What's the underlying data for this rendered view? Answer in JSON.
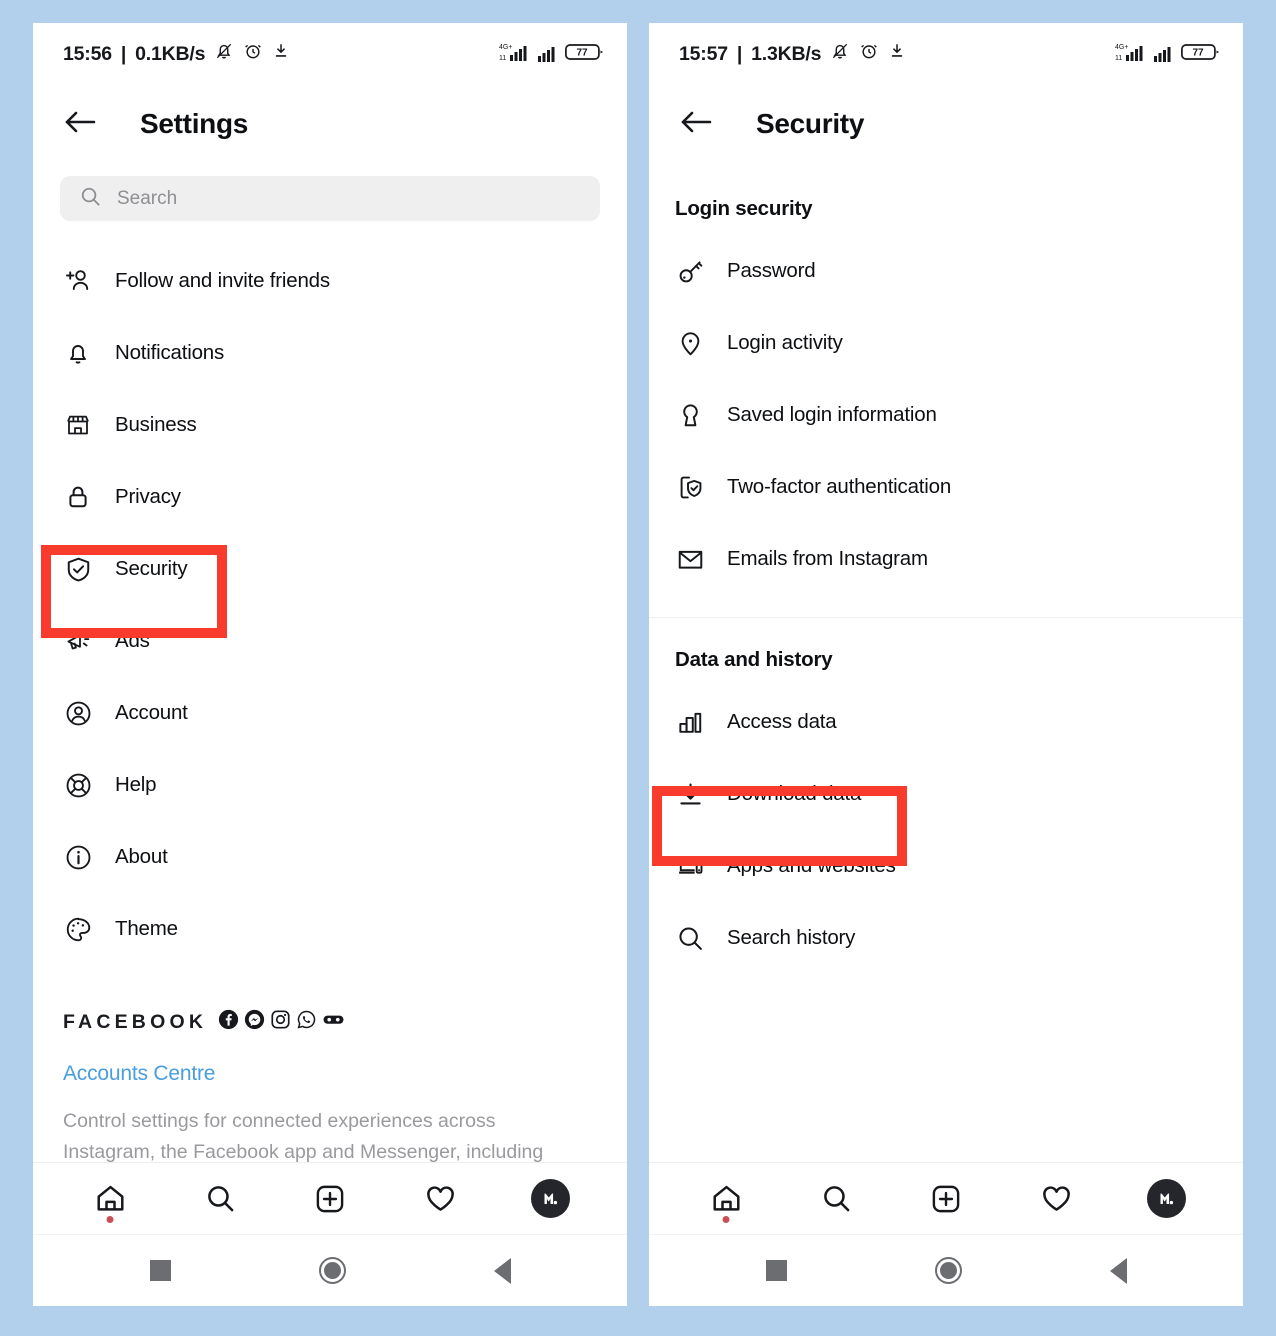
{
  "theme": {
    "page_background": "#b2cfeb",
    "panel_background": "#ffffff",
    "highlight_color": "#f93b2e",
    "link_color": "#4a9ede",
    "muted_text": "#9a9a9e",
    "search_field_background": "#efeff0",
    "notification_dot": "#c84f56"
  },
  "left_phone": {
    "status_bar": {
      "time": "15:56",
      "separator": "|",
      "network_speed": "0.1KB/s",
      "icons_left": [
        "bell-off-icon",
        "alarm-clock-icon",
        "download-icon"
      ],
      "network_label": "4G+",
      "icons_right": [
        "signal-4g-icon",
        "signal-icon",
        "battery-icon"
      ],
      "battery_level": "77"
    },
    "header": {
      "back_icon": "arrow-left-icon",
      "title": "Settings"
    },
    "search": {
      "icon": "search-icon",
      "placeholder": "Search",
      "value": ""
    },
    "menu_items": [
      {
        "label": "Follow and invite friends",
        "icon": "add-person-icon",
        "highlighted": false
      },
      {
        "label": "Notifications",
        "icon": "bell-icon",
        "highlighted": false
      },
      {
        "label": "Business",
        "icon": "storefront-icon",
        "highlighted": false
      },
      {
        "label": "Privacy",
        "icon": "lock-icon",
        "highlighted": false
      },
      {
        "label": "Security",
        "icon": "shield-check-icon",
        "highlighted": true
      },
      {
        "label": "Ads",
        "icon": "megaphone-icon",
        "highlighted": false
      },
      {
        "label": "Account",
        "icon": "user-circle-icon",
        "highlighted": false
      },
      {
        "label": "Help",
        "icon": "lifebuoy-icon",
        "highlighted": false
      },
      {
        "label": "About",
        "icon": "info-circle-icon",
        "highlighted": false
      },
      {
        "label": "Theme",
        "icon": "palette-icon",
        "highlighted": false
      }
    ],
    "facebook_block": {
      "heading": "FACEBOOK",
      "brand_icons": [
        "facebook-icon",
        "messenger-icon",
        "instagram-icon",
        "whatsapp-icon",
        "oculus-icon"
      ],
      "link": "Accounts Centre",
      "description_line1": "Control settings for connected experiences across",
      "description_line2": "Instagram, the Facebook app and Messenger, including"
    }
  },
  "right_phone": {
    "status_bar": {
      "time": "15:57",
      "separator": "|",
      "network_speed": "1.3KB/s",
      "icons_left": [
        "bell-off-icon",
        "alarm-clock-icon",
        "download-icon"
      ],
      "network_label": "4G+",
      "icons_right": [
        "signal-4g-icon",
        "signal-icon",
        "battery-icon"
      ],
      "battery_level": "77"
    },
    "header": {
      "back_icon": "arrow-left-icon",
      "title": "Security"
    },
    "sections": [
      {
        "title": "Login security",
        "items": [
          {
            "label": "Password",
            "icon": "key-icon",
            "highlighted": false
          },
          {
            "label": "Login activity",
            "icon": "location-pin-icon",
            "highlighted": false
          },
          {
            "label": "Saved login information",
            "icon": "keyhole-icon",
            "highlighted": false
          },
          {
            "label": "Two-factor authentication",
            "icon": "phone-shield-icon",
            "highlighted": false
          },
          {
            "label": "Emails from Instagram",
            "icon": "envelope-icon",
            "highlighted": false
          }
        ]
      },
      {
        "title": "Data and history",
        "items": [
          {
            "label": "Access data",
            "icon": "bar-chart-icon",
            "highlighted": false
          },
          {
            "label": "Download data",
            "icon": "download-arrow-icon",
            "highlighted": true
          },
          {
            "label": "Apps and websites",
            "icon": "devices-icon",
            "highlighted": false
          },
          {
            "label": "Search history",
            "icon": "search-icon",
            "highlighted": false
          }
        ]
      }
    ]
  },
  "tabbar": {
    "items": [
      {
        "name": "home",
        "icon": "home-icon",
        "active": true,
        "has_dot": true
      },
      {
        "name": "search",
        "icon": "search-icon",
        "active": false,
        "has_dot": false
      },
      {
        "name": "create",
        "icon": "plus-square-icon",
        "active": false,
        "has_dot": false
      },
      {
        "name": "activity",
        "icon": "heart-icon",
        "active": false,
        "has_dot": false
      },
      {
        "name": "profile",
        "icon": "avatar-icon",
        "active": false,
        "has_dot": false
      }
    ]
  },
  "android_navbar": {
    "buttons": [
      {
        "name": "recents",
        "icon": "square-icon"
      },
      {
        "name": "home",
        "icon": "circle-icon"
      },
      {
        "name": "back",
        "icon": "triangle-left-icon"
      }
    ]
  }
}
